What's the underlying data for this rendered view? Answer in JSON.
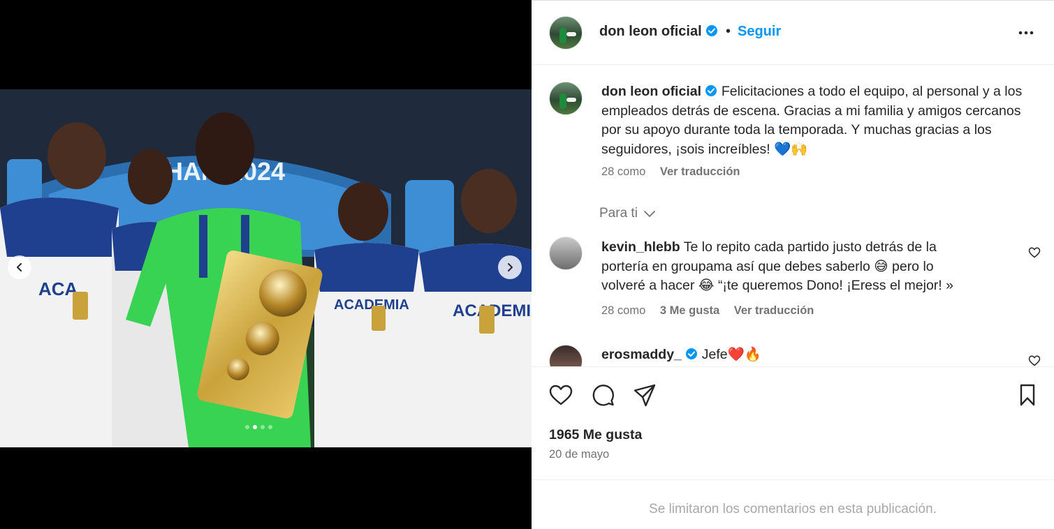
{
  "post": {
    "username": "don leon oficial",
    "follow_label": "Seguir",
    "separator": "•",
    "caption": "Felicitaciones a todo el equipo, al personal y a los empleados detrás de escena. Gracias a mi familia y amigos cercanos por su apoyo durante toda la temporada. Y muchas gracias a los seguidores, ¡sois increíbles! 💙🙌",
    "caption_time": "28 como",
    "caption_translate": "Ver traducción",
    "likes": "1965 Me gusta",
    "date": "20 de mayo",
    "comments_limited": "Se limitaron los comentarios en esta publicación."
  },
  "photo": {
    "banner_text": "CHAM 2024",
    "shirt_text": "ACADEMIA",
    "carousel_dots": 4,
    "carousel_active": 2
  },
  "section": {
    "para_ti": "Para ti"
  },
  "comments": [
    {
      "username": "kevin_hlebb",
      "text": "Te lo repito cada partido justo detrás de la portería en groupama así que debes saberlo 😅 pero lo volveré a hacer 😂 “¡te queremos Dono! ¡Eress el mejor! »",
      "time": "28 como",
      "likes": "3 Me gusta",
      "translate": "Ver traducción"
    },
    {
      "username": "erosmaddy_",
      "text": "Jefe❤️🔥"
    }
  ],
  "icons": {
    "verified": "verified-badge-icon",
    "more": "more-options-icon",
    "like": "heart-icon",
    "comment": "comment-icon",
    "share": "share-icon",
    "save": "bookmark-icon",
    "prev": "chevron-left-icon",
    "next": "chevron-right-icon"
  },
  "colors": {
    "accent": "#0095f6",
    "text": "#262626",
    "muted": "#737373",
    "verified": "#0095f6"
  }
}
